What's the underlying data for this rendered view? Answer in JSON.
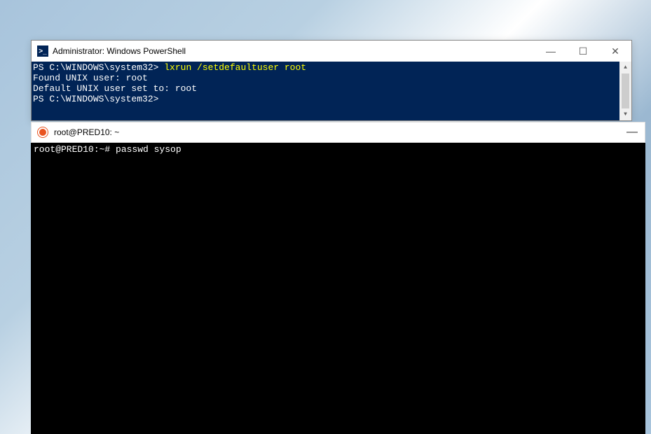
{
  "powershell": {
    "title": "Administrator: Windows PowerShell",
    "line1_prompt": "PS C:\\WINDOWS\\system32> ",
    "line1_cmd": "lxrun /setdefaultuser root",
    "line2": "Found UNIX user: root",
    "line3": "Default UNIX user set to: root",
    "line4": "PS C:\\WINDOWS\\system32>",
    "minimize": "—",
    "maximize": "☐",
    "close": "✕",
    "scroll_up": "▲",
    "scroll_down": "▼"
  },
  "bash": {
    "title": "root@PRED10: ~",
    "prompt": "root@PRED10:~# passwd sysop",
    "minimize": "—"
  }
}
